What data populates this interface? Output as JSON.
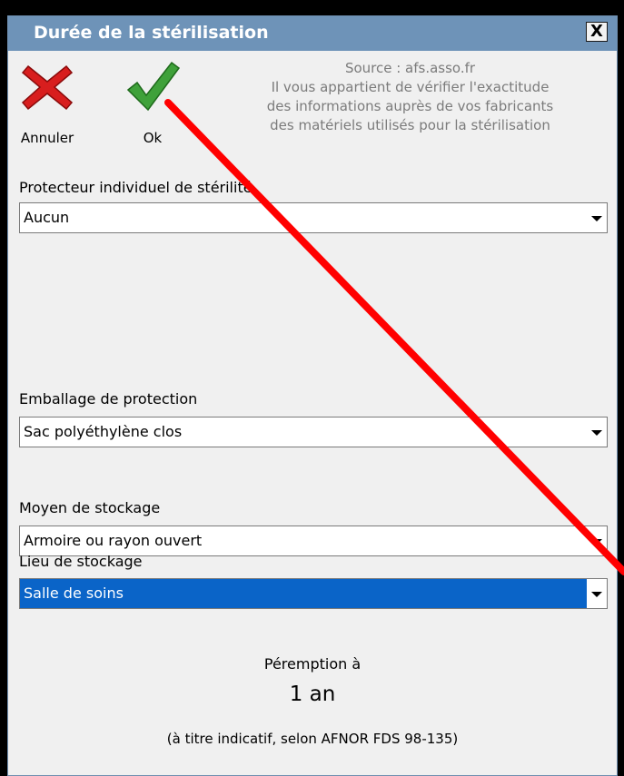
{
  "window": {
    "title": "Durée de la stérilisation",
    "close_label": "X"
  },
  "toolbar": {
    "cancel_label": "Annuler",
    "ok_label": "Ok"
  },
  "source_note": {
    "line1": "Source : afs.asso.fr",
    "line2": "Il vous appartient de vérifier l'exactitude",
    "line3": "des informations auprès de vos fabricants",
    "line4": "des matériels utilisés pour la stérilisation"
  },
  "fields": {
    "protecteur": {
      "label": "Protecteur individuel de stérilité",
      "value": "Aucun"
    },
    "emballage": {
      "label": "Emballage de protection",
      "value": "Sac polyéthylène clos"
    },
    "moyen": {
      "label": "Moyen de stockage",
      "value": "Armoire ou rayon ouvert"
    },
    "lieu": {
      "label": "Lieu de stockage",
      "value": "Salle de soins"
    }
  },
  "result": {
    "heading": "Péremption à",
    "value": "1 an",
    "note": "(à titre indicatif, selon AFNOR FDS 98-135)"
  },
  "colors": {
    "titlebar": "#6e93b8",
    "selection": "#0a64c8",
    "annotation_line": "#ff0000"
  },
  "icons": {
    "cancel": "red-x-icon",
    "ok": "green-check-icon",
    "close": "close-icon",
    "dropdown": "chevron-down-icon"
  }
}
